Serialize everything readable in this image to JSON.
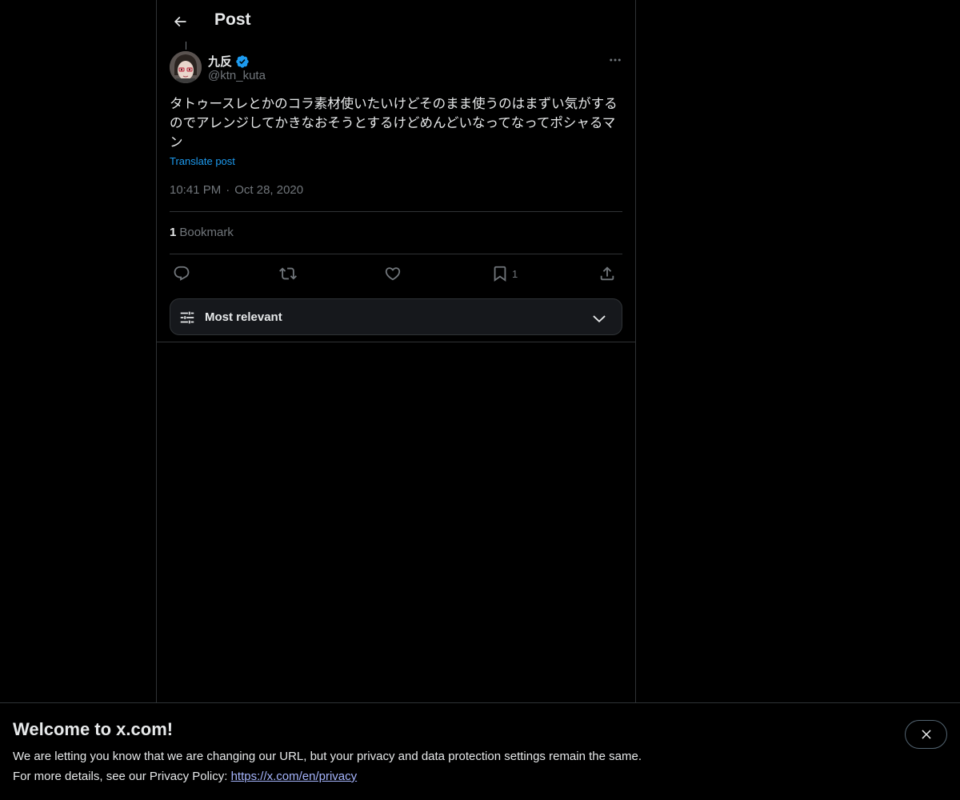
{
  "header": {
    "title": "Post"
  },
  "post": {
    "author": {
      "display_name": "九反",
      "handle": "@ktn_kuta",
      "verified": true
    },
    "text": "タトゥースレとかのコラ素材使いたいけどそのまま使うのはまずい気がするのでアレンジしてかきなおそうとするけどめんどいなってなってポシャるマン",
    "translate_label": "Translate post",
    "time": "10:41 PM",
    "separator": "·",
    "date": "Oct 28, 2020",
    "bookmarks": {
      "count": "1",
      "label": "Bookmark"
    },
    "actions": {
      "bookmark_count": "1"
    }
  },
  "sort": {
    "label": "Most relevant"
  },
  "banner": {
    "title": "Welcome to x.com!",
    "line1": "We are letting you know that we are changing our URL, but your privacy and data protection settings remain the same.",
    "line2_prefix": "For more details, see our Privacy Policy: ",
    "link": "https://x.com/en/privacy"
  },
  "icons": {
    "back": "arrow-left-icon",
    "verified": "verified-badge-icon",
    "more": "more-icon",
    "reply": "reply-icon",
    "repost": "repost-icon",
    "like": "heart-icon",
    "bookmark": "bookmark-icon",
    "share": "share-icon",
    "sort": "sliders-icon",
    "chevron": "chevron-down-icon",
    "close": "close-icon"
  },
  "colors": {
    "background": "#000000",
    "text": "#e7e9ea",
    "muted": "#71767b",
    "accent": "#1d9bf0",
    "border": "#2f3336",
    "link": "#a5b4fc"
  }
}
